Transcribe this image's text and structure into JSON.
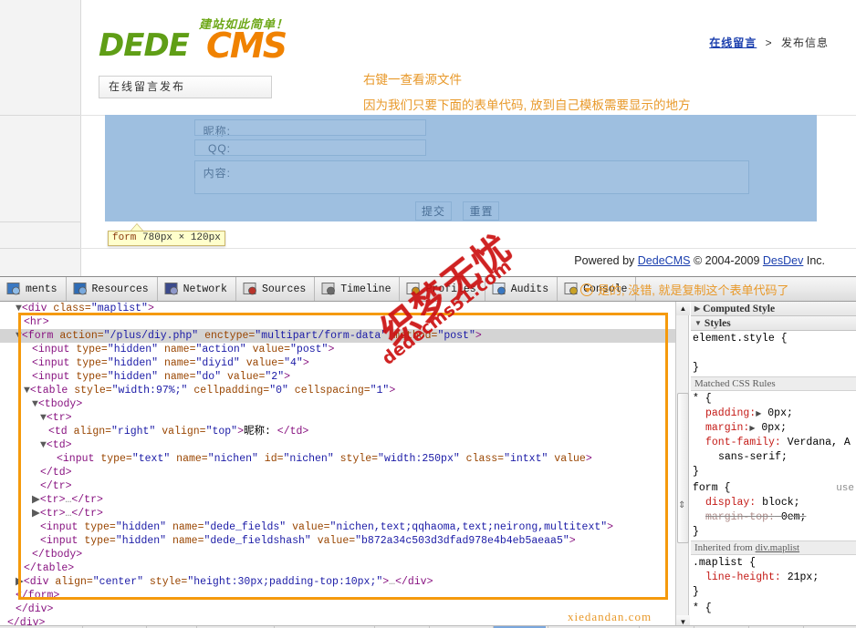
{
  "page": {
    "logo": {
      "slogan": "建站如此简单！",
      "word1": "DEDE",
      "word2": "CMS"
    },
    "tab_title": "在线留言发布",
    "breadcrumb": {
      "link": "在线留言",
      "sep": ">",
      "current": "发布信息"
    },
    "notes": [
      "右键一查看源文件",
      "因为我们只要下面的表单代码, 放到自己模板需要显示的地方"
    ],
    "form": {
      "rows": [
        {
          "label": "昵称:",
          "value": "",
          "placeholder": ""
        },
        {
          "label": "QQ:",
          "value": "",
          "placeholder": ""
        },
        {
          "label": "内容:",
          "value": "",
          "placeholder": ""
        }
      ],
      "submit_label": "提交",
      "reset_label": "重置"
    },
    "tooltip": {
      "tag": "form",
      "size": "780px × 120px"
    },
    "footer": {
      "prefix": "Powered by",
      "link1": "DedeCMS",
      "copyright": "© 2004-2009",
      "link2": "DesDev",
      "suffix": "Inc."
    },
    "watermark_red": {
      "cn": "织梦无忧",
      "en": "dedecms51.com"
    },
    "watermark_bottom": "xiedandan.com"
  },
  "devtools": {
    "tabs": [
      {
        "label": "ments",
        "icon": "elements-icon"
      },
      {
        "label": "Resources",
        "icon": "resources-icon"
      },
      {
        "label": "Network",
        "icon": "network-icon"
      },
      {
        "label": "Sources",
        "icon": "sources-icon"
      },
      {
        "label": "Timeline",
        "icon": "timeline-icon"
      },
      {
        "label": "Profiles",
        "icon": "profiles-icon"
      },
      {
        "label": "Audits",
        "icon": "audits-icon"
      },
      {
        "label": "Console",
        "icon": "console-icon"
      }
    ],
    "toolbar_note": "是的, 没错, 就是复制这个表单代码了",
    "accent_highlight": "#f59a0c",
    "accent_note": "#e8992a",
    "code": {
      "lines": [
        {
          "indent": 1,
          "arrow": "▼",
          "selected": false,
          "parts": [
            {
              "t": "tg",
              "s": "<div"
            },
            {
              "t": "at",
              "s": " class="
            },
            {
              "t": "vl",
              "s": "\"maplist\""
            },
            {
              "t": "tg",
              "s": ">"
            }
          ]
        },
        {
          "indent": 2,
          "arrow": "",
          "selected": false,
          "parts": [
            {
              "t": "tg",
              "s": "<hr>"
            }
          ]
        },
        {
          "indent": 1,
          "arrow": "▼",
          "selected": true,
          "parts": [
            {
              "t": "tg",
              "s": "<form"
            },
            {
              "t": "at",
              "s": " action="
            },
            {
              "t": "vl",
              "s": "\"/plus/diy.php\""
            },
            {
              "t": "at",
              "s": " enctype="
            },
            {
              "t": "vl",
              "s": "\"multipart/form-data\""
            },
            {
              "t": "at",
              "s": " method="
            },
            {
              "t": "vl",
              "s": "\"post\""
            },
            {
              "t": "tg",
              "s": ">"
            }
          ]
        },
        {
          "indent": 3,
          "arrow": "",
          "selected": false,
          "parts": [
            {
              "t": "tg",
              "s": "<input"
            },
            {
              "t": "at",
              "s": " type="
            },
            {
              "t": "vl",
              "s": "\"hidden\""
            },
            {
              "t": "at",
              "s": " name="
            },
            {
              "t": "vl",
              "s": "\"action\""
            },
            {
              "t": "at",
              "s": " value="
            },
            {
              "t": "vl",
              "s": "\"post\""
            },
            {
              "t": "tg",
              "s": ">"
            }
          ]
        },
        {
          "indent": 3,
          "arrow": "",
          "selected": false,
          "parts": [
            {
              "t": "tg",
              "s": "<input"
            },
            {
              "t": "at",
              "s": " type="
            },
            {
              "t": "vl",
              "s": "\"hidden\""
            },
            {
              "t": "at",
              "s": " name="
            },
            {
              "t": "vl",
              "s": "\"diyid\""
            },
            {
              "t": "at",
              "s": " value="
            },
            {
              "t": "vl",
              "s": "\"4\""
            },
            {
              "t": "tg",
              "s": ">"
            }
          ]
        },
        {
          "indent": 3,
          "arrow": "",
          "selected": false,
          "parts": [
            {
              "t": "tg",
              "s": "<input"
            },
            {
              "t": "at",
              "s": " type="
            },
            {
              "t": "vl",
              "s": "\"hidden\""
            },
            {
              "t": "at",
              "s": " name="
            },
            {
              "t": "vl",
              "s": "\"do\""
            },
            {
              "t": "at",
              "s": " value="
            },
            {
              "t": "vl",
              "s": "\"2\""
            },
            {
              "t": "tg",
              "s": ">"
            }
          ]
        },
        {
          "indent": 2,
          "arrow": "▼",
          "selected": false,
          "parts": [
            {
              "t": "tg",
              "s": "<table"
            },
            {
              "t": "at",
              "s": " style="
            },
            {
              "t": "vl",
              "s": "\"width:97%;\""
            },
            {
              "t": "at",
              "s": " cellpadding="
            },
            {
              "t": "vl",
              "s": "\"0\""
            },
            {
              "t": "at",
              "s": " cellspacing="
            },
            {
              "t": "vl",
              "s": "\"1\""
            },
            {
              "t": "tg",
              "s": ">"
            }
          ]
        },
        {
          "indent": 3,
          "arrow": "▼",
          "selected": false,
          "parts": [
            {
              "t": "tg",
              "s": "<tbody>"
            }
          ]
        },
        {
          "indent": 4,
          "arrow": "▼",
          "selected": false,
          "parts": [
            {
              "t": "tg",
              "s": "<tr>"
            }
          ]
        },
        {
          "indent": 5,
          "arrow": "",
          "selected": false,
          "parts": [
            {
              "t": "tg",
              "s": "<td"
            },
            {
              "t": "at",
              "s": " align="
            },
            {
              "t": "vl",
              "s": "\"right\""
            },
            {
              "t": "at",
              "s": " valign="
            },
            {
              "t": "vl",
              "s": "\"top\""
            },
            {
              "t": "tg",
              "s": ">"
            },
            {
              "t": "txt",
              "s": "昵称: "
            },
            {
              "t": "tg",
              "s": "</td>"
            }
          ]
        },
        {
          "indent": 4,
          "arrow": "▼",
          "selected": false,
          "parts": [
            {
              "t": "tg",
              "s": "<td>"
            }
          ]
        },
        {
          "indent": 6,
          "arrow": "",
          "selected": false,
          "parts": [
            {
              "t": "tg",
              "s": "<input"
            },
            {
              "t": "at",
              "s": " type="
            },
            {
              "t": "vl",
              "s": "\"text\""
            },
            {
              "t": "at",
              "s": " name="
            },
            {
              "t": "vl",
              "s": "\"nichen\""
            },
            {
              "t": "at",
              "s": " id="
            },
            {
              "t": "vl",
              "s": "\"nichen\""
            },
            {
              "t": "at",
              "s": " style="
            },
            {
              "t": "vl",
              "s": "\"width:250px\""
            },
            {
              "t": "at",
              "s": " class="
            },
            {
              "t": "vl",
              "s": "\"intxt\""
            },
            {
              "t": "at",
              "s": " value"
            },
            {
              "t": "tg",
              "s": ">"
            }
          ]
        },
        {
          "indent": 4,
          "arrow": "",
          "selected": false,
          "parts": [
            {
              "t": "tg",
              "s": "</td>"
            }
          ]
        },
        {
          "indent": 4,
          "arrow": "",
          "selected": false,
          "parts": [
            {
              "t": "tg",
              "s": "</tr>"
            }
          ]
        },
        {
          "indent": 3,
          "arrow": "▶",
          "selected": false,
          "parts": [
            {
              "t": "tg",
              "s": "<tr>"
            },
            {
              "t": "dots",
              "s": "…"
            },
            {
              "t": "tg",
              "s": "</tr>"
            }
          ]
        },
        {
          "indent": 3,
          "arrow": "▶",
          "selected": false,
          "parts": [
            {
              "t": "tg",
              "s": "<tr>"
            },
            {
              "t": "dots",
              "s": "…"
            },
            {
              "t": "tg",
              "s": "</tr>"
            }
          ]
        },
        {
          "indent": 4,
          "arrow": "",
          "selected": false,
          "parts": [
            {
              "t": "tg",
              "s": "<input"
            },
            {
              "t": "at",
              "s": " type="
            },
            {
              "t": "vl",
              "s": "\"hidden\""
            },
            {
              "t": "at",
              "s": " name="
            },
            {
              "t": "vl",
              "s": "\"dede_fields\""
            },
            {
              "t": "at",
              "s": " value="
            },
            {
              "t": "vl",
              "s": "\"nichen,text;qqhaoma,text;neirong,multitext\""
            },
            {
              "t": "tg",
              "s": ">"
            }
          ]
        },
        {
          "indent": 4,
          "arrow": "",
          "selected": false,
          "parts": [
            {
              "t": "tg",
              "s": "<input"
            },
            {
              "t": "at",
              "s": " type="
            },
            {
              "t": "vl",
              "s": "\"hidden\""
            },
            {
              "t": "at",
              "s": " name="
            },
            {
              "t": "vl",
              "s": "\"dede_fieldshash\""
            },
            {
              "t": "at",
              "s": " value="
            },
            {
              "t": "vl",
              "s": "\"b872a34c503d3dfad978e4b4eb5aeaa5\""
            },
            {
              "t": "tg",
              "s": ">"
            }
          ]
        },
        {
          "indent": 3,
          "arrow": "",
          "selected": false,
          "parts": [
            {
              "t": "tg",
              "s": "</tbody>"
            }
          ]
        },
        {
          "indent": 2,
          "arrow": "",
          "selected": false,
          "parts": [
            {
              "t": "tg",
              "s": "</table>"
            }
          ]
        },
        {
          "indent": 1,
          "arrow": "▶",
          "selected": false,
          "parts": [
            {
              "t": "tg",
              "s": "<div"
            },
            {
              "t": "at",
              "s": " align="
            },
            {
              "t": "vl",
              "s": "\"center\""
            },
            {
              "t": "at",
              "s": " style="
            },
            {
              "t": "vl",
              "s": "\"height:30px;padding-top:10px;\""
            },
            {
              "t": "tg",
              "s": ">"
            },
            {
              "t": "dots",
              "s": "…"
            },
            {
              "t": "tg",
              "s": "</div>"
            }
          ]
        },
        {
          "indent": 1,
          "arrow": "",
          "selected": false,
          "parts": [
            {
              "t": "tg",
              "s": "</form>"
            }
          ]
        },
        {
          "indent": 1,
          "arrow": "",
          "selected": false,
          "parts": [
            {
              "t": "tg",
              "s": "</div>"
            }
          ]
        },
        {
          "indent": 0,
          "arrow": "",
          "selected": false,
          "parts": [
            {
              "t": "tg",
              "s": "</div>"
            }
          ]
        }
      ]
    },
    "styles": {
      "computed_header": "Computed Style",
      "styles_header": "Styles",
      "element_style": "element.style {",
      "element_style_close": "}",
      "matched_header": "Matched CSS Rules",
      "inherited_header_prefix": "Inherited from",
      "inherited_header_link": "div.maplist",
      "rules": [
        {
          "selector": "* {",
          "badge": "",
          "declarations": [
            {
              "prop": "padding:",
              "value": "0px;",
              "has_triangle": true,
              "struck": false
            },
            {
              "prop": "margin:",
              "value": "0px;",
              "has_triangle": true,
              "struck": false
            },
            {
              "prop": "font-family:",
              "value": "Verdana, A",
              "has_triangle": false,
              "struck": false
            },
            {
              "prop": "",
              "value": "sans-serif;",
              "has_triangle": false,
              "struck": false
            }
          ],
          "close": "}"
        },
        {
          "selector": "form {",
          "badge": "use",
          "declarations": [
            {
              "prop": "display:",
              "value": "block;",
              "has_triangle": false,
              "struck": false
            },
            {
              "prop": "margin-top:",
              "value": "0em;",
              "has_triangle": false,
              "struck": true
            }
          ],
          "close": "}"
        },
        {
          "selector": ".maplist {",
          "badge": "",
          "declarations": [
            {
              "prop": "line-height:",
              "value": "21px;",
              "has_triangle": false,
              "struck": false
            }
          ],
          "close": "}"
        },
        {
          "selector": "* {",
          "badge": "",
          "declarations": [],
          "close": ""
        }
      ]
    },
    "scrollbar": {
      "up": "▲",
      "down": "▼",
      "splitter": "⇕"
    }
  }
}
